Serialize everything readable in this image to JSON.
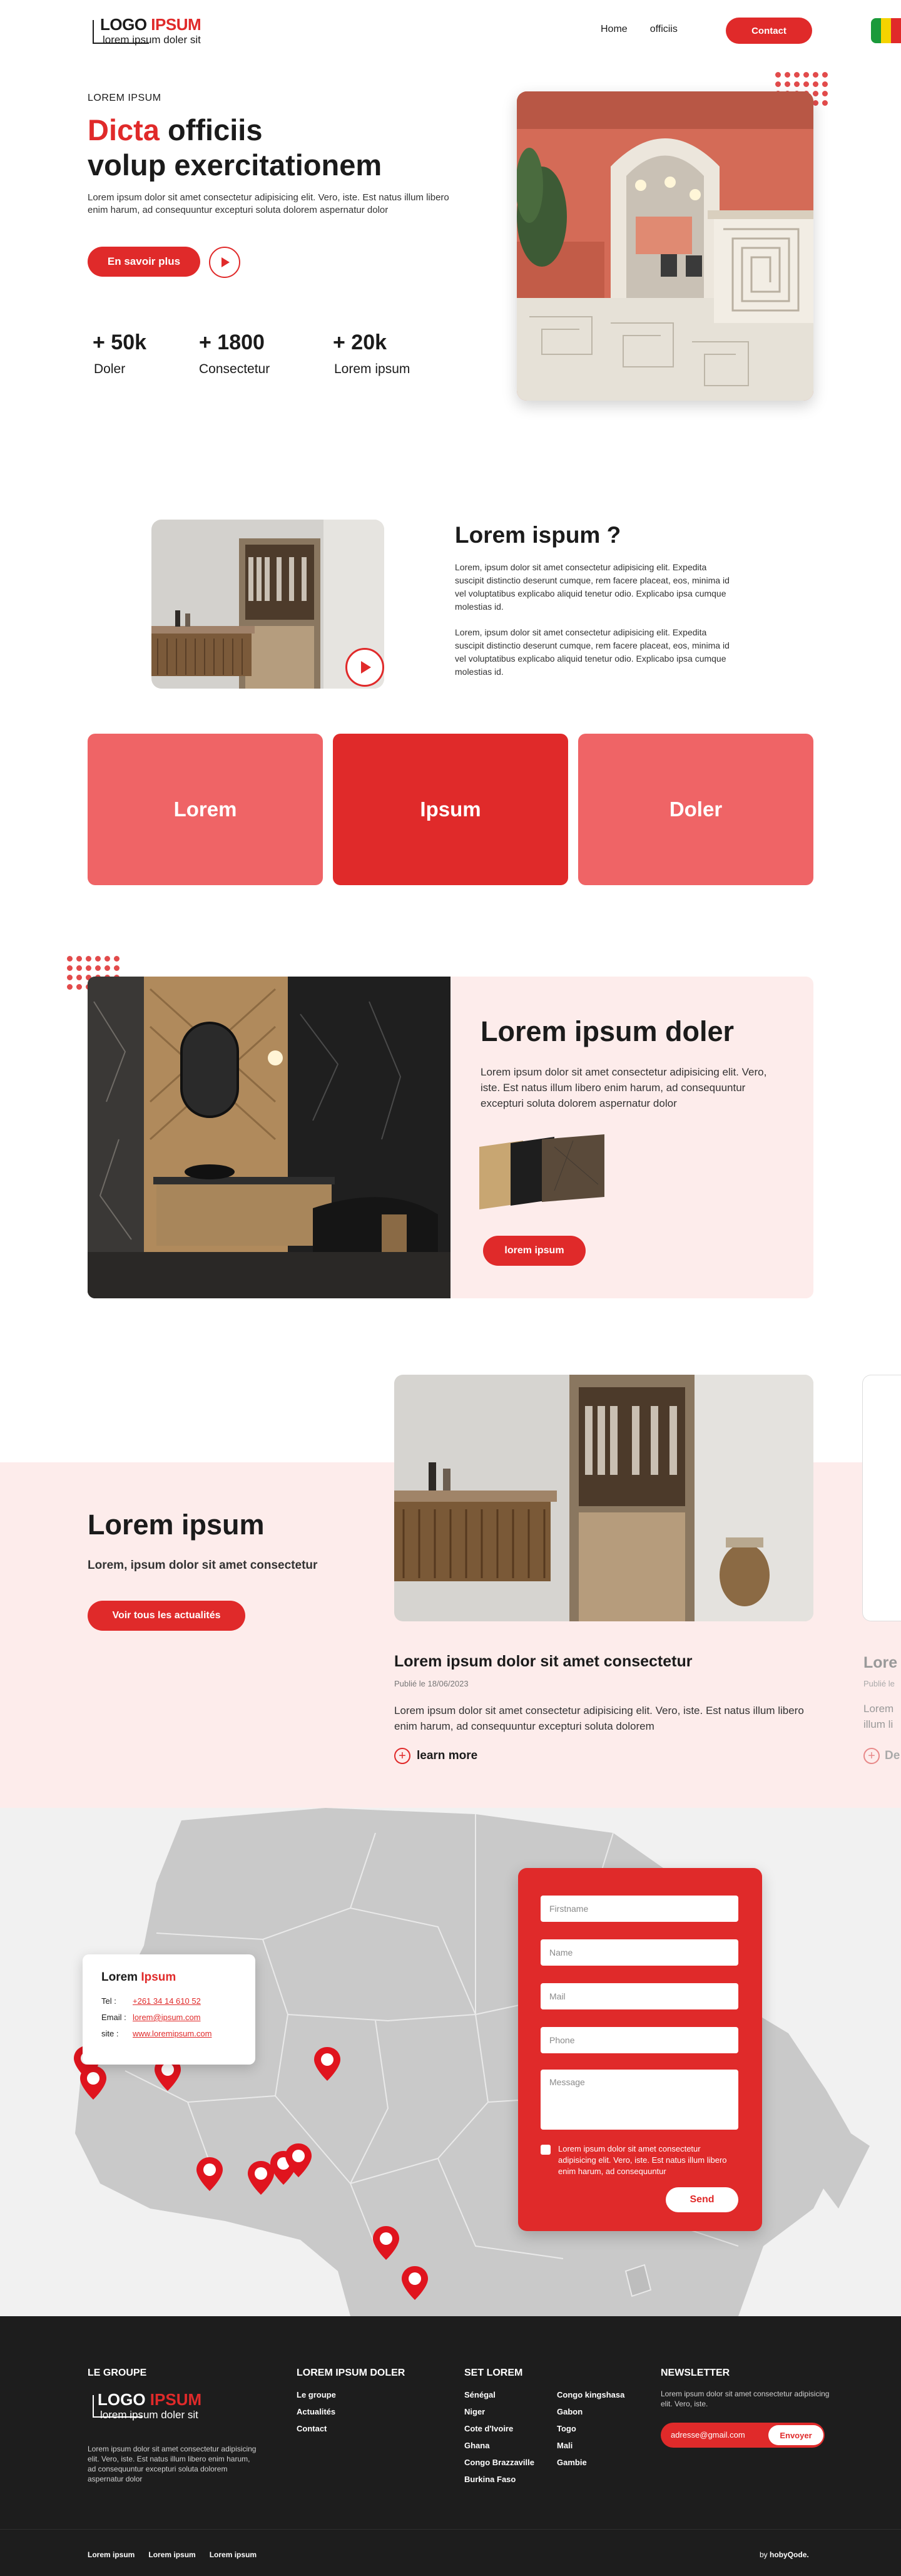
{
  "header": {
    "logo_main": "LOGO",
    "logo_accent": "IPSUM",
    "logo_tagline": "lorem ipsum doler sit",
    "nav": [
      "Home",
      "officiis"
    ],
    "contact_label": "Contact"
  },
  "hero": {
    "kicker": "LOREM IPSUM",
    "title_accent": "Dicta",
    "title_rest1": " officiis",
    "title_line2": "volup exercitationem",
    "text": "Lorem ipsum dolor sit amet consectetur adipisicing elit. Vero, iste. Est natus illum libero enim harum, ad consequuntur excepturi soluta dolorem aspernatur dolor",
    "cta_label": "En savoir plus",
    "stats": [
      {
        "value": "+ 50k",
        "label": "Doler"
      },
      {
        "value": "+ 1800",
        "label": "Consectetur"
      },
      {
        "value": "+ 20k",
        "label": "Lorem ipsum"
      }
    ]
  },
  "about": {
    "title": "Lorem ispum ?",
    "para1": "Lorem, ipsum dolor sit amet consectetur adipisicing elit. Expedita suscipit distinctio deserunt cumque, rem facere placeat, eos, minima id vel voluptatibus explicabo aliquid tenetur odio. Explicabo ipsa cumque molestias id.",
    "para2": "Lorem, ipsum dolor sit amet consectetur adipisicing elit. Expedita suscipit distinctio deserunt cumque, rem facere placeat, eos, minima id vel voluptatibus explicabo aliquid tenetur odio. Explicabo ipsa cumque molestias id."
  },
  "cards": [
    "Lorem",
    "Ipsum",
    "Doler"
  ],
  "feature": {
    "title": "Lorem ipsum doler",
    "text": "Lorem ipsum dolor sit amet consectetur adipisicing elit. Vero, iste. Est natus illum libero enim harum, ad consequuntur excepturi soluta dolorem aspernatur dolor",
    "cta_label": "lorem ipsum"
  },
  "news": {
    "title": "Lorem ipsum",
    "subtitle": "Lorem, ipsum dolor sit amet consectetur",
    "cta_label": "Voir tous les actualités",
    "article_title": "Lorem ipsum dolor sit amet consectetur",
    "article_date": "Publié le 18/06/2023",
    "article_text": "Lorem ipsum dolor sit amet consectetur adipisicing elit. Vero, iste. Est natus illum libero enim harum, ad consequuntur excepturi soluta dolorem",
    "learn_more": "learn more",
    "next_title": "Lore",
    "next_date": "Publié le",
    "next_text1": "Lorem",
    "next_text2": "illum li",
    "next_more": "De"
  },
  "contact_card": {
    "title_main": "Lorem",
    "title_accent": "Ipsum",
    "tel_label": "Tel :",
    "tel_value": "+261 34 14 610 52",
    "email_label": "Email :",
    "email_value": "lorem@ipsum.com",
    "site_label": "site :",
    "site_value": "www.loremipsum.com"
  },
  "form": {
    "placeholders": [
      "Firstname",
      "Name",
      "Mail",
      "Phone",
      "Message"
    ],
    "consent": "Lorem ipsum dolor sit amet consectetur adipisicing elit. Vero, iste. Est natus illum libero enim harum, ad consequuntur",
    "send_label": "Send"
  },
  "footer": {
    "col1_title": "LE GROUPE",
    "logo_main": "LOGO",
    "logo_accent": "IPSUM",
    "logo_tagline": "lorem ipsum doler sit",
    "col1_text": "Lorem ipsum dolor sit amet consectetur adipisicing elit. Vero, iste. Est natus illum libero enim harum, ad consequuntur excepturi soluta dolorem aspernatur dolor",
    "col2_title": "LOREM IPSUM DOLER",
    "col2_links": [
      "Le groupe",
      "Actualités",
      "Contact"
    ],
    "col3_title": "SET LOREM",
    "col3_links_a": [
      "Sénégal",
      "Niger",
      "Cote d'Ivoire",
      "Ghana",
      "Congo Brazzaville",
      "Burkina Faso"
    ],
    "col3_links_b": [
      "Congo kingshasa",
      "Gabon",
      "Togo",
      "Mali",
      "Gambie"
    ],
    "col4_title": "NEWSLETTER",
    "col4_text": "Lorem ipsum dolor sit amet consectetur adipisicing elit. Vero, iste.",
    "newsletter_placeholder": "adresse@gmail.com",
    "newsletter_btn": "Envoyer",
    "bottom_links": [
      "Lorem ipsum",
      "Lorem ipsum",
      "Lorem ipsum"
    ],
    "credit_prefix": "by",
    "credit_name": "hobyQode."
  },
  "colors": {
    "accent": "#e02a2a",
    "card1": "#ef6466",
    "card3": "#ef6466",
    "pink_bg": "#fdeceb",
    "footer": "#1d1d1d"
  }
}
